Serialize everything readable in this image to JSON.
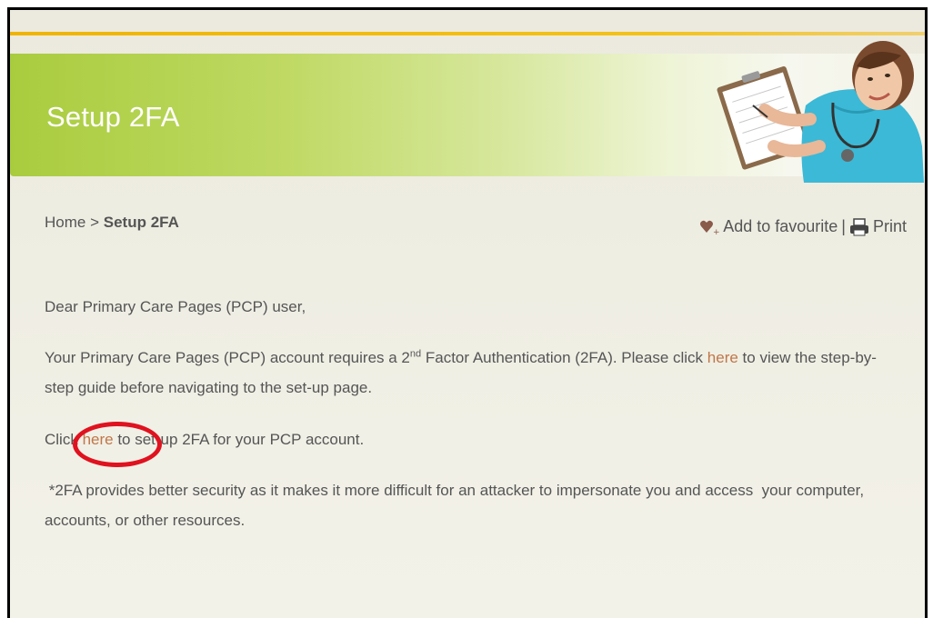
{
  "banner": {
    "title": "Setup 2FA"
  },
  "breadcrumb": {
    "home": "Home",
    "separator": ">",
    "current": "Setup 2FA"
  },
  "tools": {
    "favourite_label": "Add to favourite",
    "separator": "|",
    "print_label": "Print"
  },
  "content": {
    "greeting": "Dear Primary Care Pages (PCP) user,",
    "para2_before_sup": "Your Primary Care Pages (PCP) account requires a 2",
    "para2_sup": "nd",
    "para2_after_sup": " Factor Authentication (2FA). Please click ",
    "para2_link": "here",
    "para2_end": " to view the step-by-step guide before navigating to the set-up page.",
    "para3_before": "Click ",
    "para3_link": "here",
    "para3_after": " to set-up 2FA for your PCP account.",
    "note": " *2FA provides better security as it makes it more difficult for an attacker to impersonate you and access  your computer, accounts, or other resources."
  },
  "colors": {
    "banner_green": "#a9cc3e",
    "link": "#c0774a",
    "highlight_circle": "#e0121f",
    "top_line": "#f0b400"
  },
  "icons": {
    "favourite": "heart-plus-icon",
    "print": "printer-icon"
  }
}
